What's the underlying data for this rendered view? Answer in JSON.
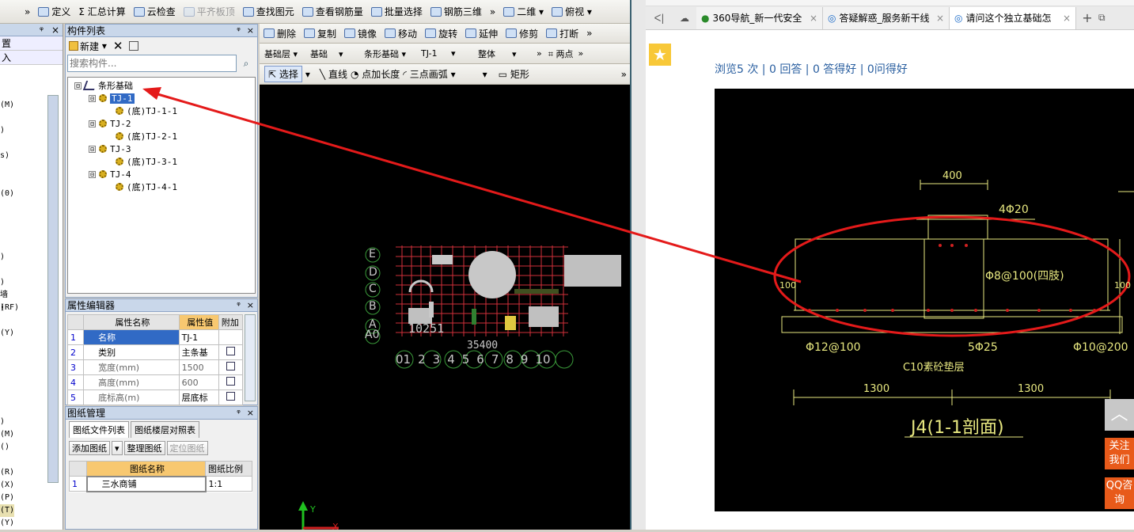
{
  "main_toolbar": {
    "expand": "»",
    "items": [
      {
        "label": "定义"
      },
      {
        "label": "Σ 汇总计算"
      },
      {
        "label": "云检查"
      },
      {
        "label": "平齐板顶"
      },
      {
        "label": "查找图元"
      },
      {
        "label": "查看钢筋量"
      },
      {
        "label": "批量选择"
      },
      {
        "label": "钢筋三维"
      },
      {
        "label": "»"
      },
      {
        "label": "二维"
      },
      {
        "label": "俯视"
      }
    ]
  },
  "left_strip": {
    "header_pin": "ᵠ",
    "header_close": "×",
    "items": [
      "置",
      "入",
      "(M)",
      ")",
      "s)",
      "(0)",
      ")",
      ")",
      "墙(RF)",
      ")",
      "(Y)",
      ")",
      "(M)",
      "()",
      "(R)",
      "(X)",
      "(P)",
      "(T)",
      "(Y)"
    ]
  },
  "component_list": {
    "title": "构件列表",
    "pin": "ᵠ",
    "close": "×",
    "new_label": "新建",
    "search_placeholder": "搜索构件...",
    "tree": [
      {
        "level": 0,
        "text": "条形基础",
        "toggle": "⊟"
      },
      {
        "level": 1,
        "text": "TJ-1",
        "toggle": "⊟",
        "selected": true
      },
      {
        "level": 2,
        "text": "(底)TJ-1-1"
      },
      {
        "level": 1,
        "text": "TJ-2",
        "toggle": "⊟"
      },
      {
        "level": 2,
        "text": "(底)TJ-2-1"
      },
      {
        "level": 1,
        "text": "TJ-3",
        "toggle": "⊟"
      },
      {
        "level": 2,
        "text": "(底)TJ-3-1"
      },
      {
        "level": 1,
        "text": "TJ-4",
        "toggle": "⊟"
      },
      {
        "level": 2,
        "text": "(底)TJ-4-1"
      }
    ]
  },
  "property_editor": {
    "title": "属性编辑器",
    "pin": "ᵠ",
    "close": "×",
    "col_name": "属性名称",
    "col_value": "属性值",
    "col_extra": "附加",
    "rows": [
      {
        "n": "1",
        "name": "名称",
        "value": "TJ-1"
      },
      {
        "n": "2",
        "name": "类别",
        "value": "主条基"
      },
      {
        "n": "3",
        "name": "宽度(mm)",
        "value": "1500"
      },
      {
        "n": "4",
        "name": "高度(mm)",
        "value": "600"
      },
      {
        "n": "5",
        "name": "底标高(m)",
        "value": "层底标"
      }
    ]
  },
  "drawing_mgmt": {
    "title": "图纸管理",
    "pin": "ᵠ",
    "close": "×",
    "tab1": "图纸文件列表",
    "tab2": "图纸楼层对照表",
    "add": "添加图纸",
    "organize": "整理图纸",
    "locate": "定位图纸",
    "col_name": "图纸名称",
    "col_scale": "图纸比例",
    "rows": [
      {
        "n": "1",
        "name": "三水商铺",
        "scale": "1:1"
      }
    ]
  },
  "edit_toolbar": {
    "items": [
      "删除",
      "复制",
      "镜像",
      "移动",
      "旋转",
      "延伸",
      "修剪",
      "打断"
    ],
    "expand": "»"
  },
  "layer_bar": {
    "floor": "基础层",
    "category": "基础",
    "type": "条形基础",
    "component": "TJ-1",
    "whole": "整体",
    "two_point": "两点",
    "expand": "»"
  },
  "draw_bar": {
    "select": "选择",
    "line": "直线",
    "point_len": "点加长度",
    "arc": "三点画弧",
    "rect": "矩形",
    "expand": "»"
  },
  "cad_view": {
    "row_labels": [
      "E",
      "D",
      "C",
      "B",
      "A",
      "A0"
    ],
    "col_labels": [
      "01",
      "2",
      "3",
      "4",
      "5",
      "6",
      "7",
      "8",
      "9",
      "10"
    ],
    "text_10251": "10251",
    "text_sum": "35400",
    "axis_y": "Y",
    "axis_x": "X"
  },
  "browser": {
    "tabs": [
      "360导航_新一代安全",
      "答疑解惑_服务新干线",
      "请问这个独立基础怎"
    ],
    "new_tab": "+",
    "back": "ᐸ|",
    "stats": "浏览5 次 | 0 回答 | 0 答得好 | 0问得好",
    "follow": "关注我们",
    "qq": "QQ咨询",
    "top": "︿"
  },
  "cad_image": {
    "dim_400": "400",
    "bar_top": "4Φ20",
    "stirrup": "Φ8@100(四肢)",
    "left_100": "100",
    "right_100": "100",
    "bar_left": "Φ12@100",
    "bar_mid": "5Φ25",
    "bar_right": "Φ10@200",
    "cushion": "C10素砼垫层",
    "dim_left": "1300",
    "dim_right": "1300",
    "section": "J4(1-1剖面)"
  },
  "colors": {
    "annot_red": "#e41a1a",
    "cad_yellow": "#e8e880",
    "selection": "#316ac5"
  }
}
